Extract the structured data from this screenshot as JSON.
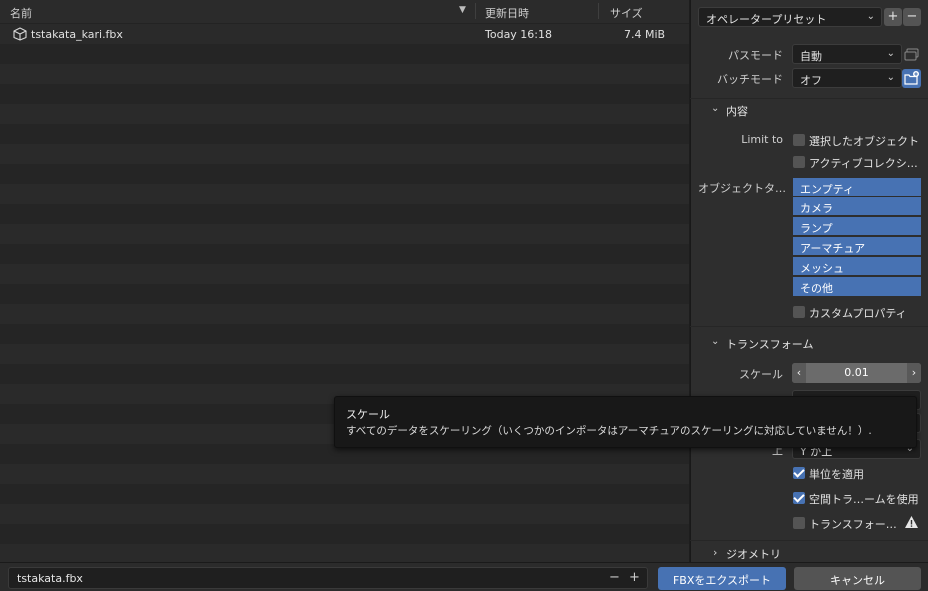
{
  "file_list": {
    "columns": {
      "name": "名前",
      "modified": "更新日時",
      "size": "サイズ"
    },
    "sort_icon": "triangle-down-icon",
    "files": [
      {
        "icon": "cube-icon",
        "name": "tstakata_kari.fbx",
        "modified": "Today 16:18",
        "size": "7.4 MiB"
      }
    ]
  },
  "side_panel": {
    "preset_label": "オペレータープリセット",
    "path_mode": {
      "label": "パスモード",
      "value": "自動"
    },
    "batch_mode": {
      "label": "バッチモード",
      "value": "オフ"
    },
    "include": {
      "title": "内容",
      "limit_to_label": "Limit to",
      "selected_objects": "選択したオブジェクト",
      "active_collection": "アクティブコレクシ…",
      "object_types_label": "オブジェクトタ…",
      "object_types": [
        "エンプティ",
        "カメラ",
        "ランプ",
        "アーマチュア",
        "メッシュ",
        "その他"
      ],
      "custom_props": "カスタムプロパティ"
    },
    "transform": {
      "title": "トランスフォーム",
      "scale_label": "スケール",
      "scale_value": "0.01",
      "up_label": "上",
      "up_value": "Y が上",
      "apply_unit": "単位を適用",
      "use_space_transform": "空間トラ…ームを使用",
      "apply_transform": "トランスフォー…"
    },
    "geometry_title": "ジオメトリ"
  },
  "tooltip": {
    "title": "スケール",
    "description": "すべてのデータをスケーリング（いくつかのインポータはアーマチュアのスケーリングに対応していません！）."
  },
  "bottom_bar": {
    "filename": "tstakata.fbx",
    "export_button": "FBXをエクスポート",
    "cancel_button": "キャンセル"
  },
  "colors": {
    "accent": "#4772b3",
    "panel": "#2e2e2e",
    "list_bg": "#282828"
  }
}
